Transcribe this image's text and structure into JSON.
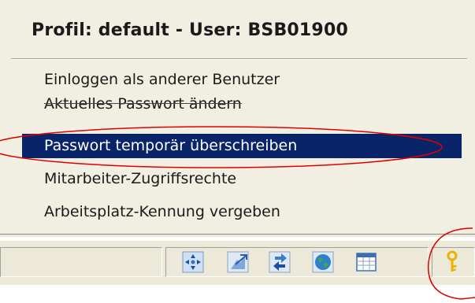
{
  "menu": {
    "header": "Profil: default - User:  BSB01900",
    "items": [
      {
        "label": "Einloggen als anderer Benutzer",
        "selected": false
      },
      {
        "label": "Aktuelles Passwort ändern",
        "selected": false
      },
      {
        "label": "Passwort temporär überschreiben",
        "selected": true
      },
      {
        "label": "Mitarbeiter-Zugriffsrechte",
        "selected": false
      },
      {
        "label": "Arbeitsplatz-Kennung vergeben",
        "selected": false
      }
    ]
  },
  "statusbar": {
    "icons": [
      "network-arrows-icon",
      "document-arrow-icon",
      "sync-arrows-icon",
      "globe-icon",
      "calendar-table-icon",
      "key-icon"
    ]
  },
  "colors": {
    "menu_background": "#f1efe2",
    "selection": "#0a246a",
    "annotation": "#e00000",
    "key": "#e8b400"
  }
}
